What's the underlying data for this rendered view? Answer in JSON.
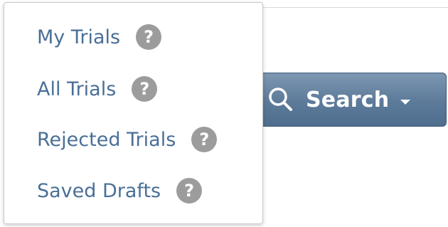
{
  "search_button": {
    "label": "Search",
    "icon": "search-icon",
    "caret_icon": "caret-down-icon",
    "color": "#5c7a99"
  },
  "dropdown": {
    "items": [
      {
        "label": "My Trials",
        "help_icon": "help-icon",
        "help_glyph": "?"
      },
      {
        "label": "All Trials",
        "help_icon": "help-icon",
        "help_glyph": "?"
      },
      {
        "label": "Rejected Trials",
        "help_icon": "help-icon",
        "help_glyph": "?"
      },
      {
        "label": "Saved Drafts",
        "help_icon": "help-icon",
        "help_glyph": "?"
      }
    ],
    "item_color": "#4a6f97",
    "help_icon_color": "#9c9c9c"
  }
}
